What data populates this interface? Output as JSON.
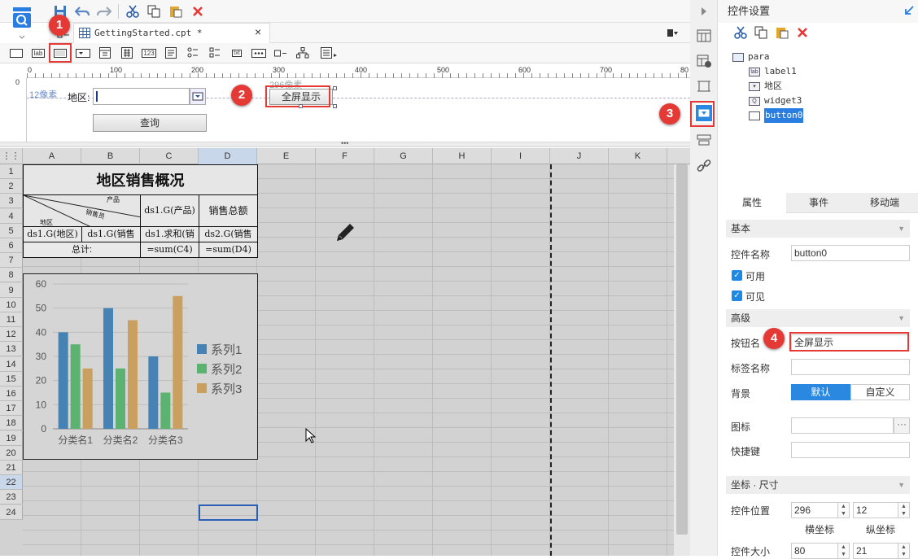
{
  "toolbar": {
    "doc_tab": "GettingStarted.cpt *",
    "icons": [
      "save-icon",
      "undo-icon",
      "redo-icon",
      "cut-icon",
      "copy-icon",
      "paste-icon",
      "delete-icon"
    ]
  },
  "ruler": {
    "ticks": [
      "0",
      "100",
      "200",
      "300",
      "400",
      "500",
      "600",
      "700",
      "80"
    ]
  },
  "param_pane": {
    "px_label_left": "12像素",
    "px_label_top": "296像素",
    "region_label": "地区:",
    "query_button": "查询",
    "fullscreen_button": "全屏显示"
  },
  "sheet": {
    "columns": [
      "A",
      "B",
      "C",
      "D",
      "E",
      "F",
      "G",
      "H",
      "I",
      "J",
      "K"
    ],
    "rows": [
      "1",
      "2",
      "3",
      "4",
      "5",
      "6",
      "7",
      "8",
      "9",
      "10",
      "11",
      "12",
      "13",
      "14",
      "15",
      "16",
      "17",
      "18",
      "19",
      "20",
      "21",
      "22",
      "23",
      "24"
    ],
    "report_title": "地区销售概况",
    "diag_product": "产品",
    "diag_salesman": "销售员",
    "diag_region": "地区",
    "c3": "ds1.G(产品)",
    "d3": "销售总额",
    "a4": "ds1.G(地区)",
    "b4": "ds1.G(销售",
    "c4": "ds1.求和(销",
    "d4": "ds2.G(销售",
    "a5": "总计:",
    "c5": "=sum(C4)",
    "d5": "=sum(D4)"
  },
  "chart_data": {
    "type": "bar",
    "categories": [
      "分类名1",
      "分类名2",
      "分类名3"
    ],
    "series": [
      {
        "name": "系列1",
        "values": [
          40,
          50,
          30
        ],
        "color": "#4682b4"
      },
      {
        "name": "系列2",
        "values": [
          35,
          25,
          15
        ],
        "color": "#5cb270"
      },
      {
        "name": "系列3",
        "values": [
          25,
          45,
          55
        ],
        "color": "#c9a05f"
      }
    ],
    "yticks": [
      "0",
      "10",
      "20",
      "30",
      "40",
      "50",
      "60"
    ],
    "ylim": [
      0,
      60
    ],
    "legend": "right",
    "grid": true
  },
  "panel": {
    "title": "控件设置",
    "tree": [
      "para",
      "label1",
      "地区",
      "widget3",
      "button0"
    ],
    "tabs": [
      "属性",
      "事件",
      "移动端"
    ],
    "basic": "基本",
    "name_label": "控件名称",
    "name_value": "button0",
    "enabled": "可用",
    "visible": "可见",
    "advanced": "高级",
    "btn_name_label": "按钮名",
    "btn_name_value": "全屏显示",
    "tag_name_label": "标签名称",
    "bg_label": "背景",
    "bg_default": "默认",
    "bg_custom": "自定义",
    "icon_label": "图标",
    "shortcut_label": "快捷键",
    "coord_section": "坐标 · 尺寸",
    "pos_label": "控件位置",
    "pos_x": "296",
    "pos_y": "12",
    "x_caption": "横坐标",
    "y_caption": "纵坐标",
    "size_label": "控件大小",
    "size_w": "80",
    "size_h": "21"
  },
  "callouts": [
    "1",
    "2",
    "3",
    "4"
  ],
  "colors": {
    "accent": "#1e88e5",
    "callout": "#e53935"
  }
}
